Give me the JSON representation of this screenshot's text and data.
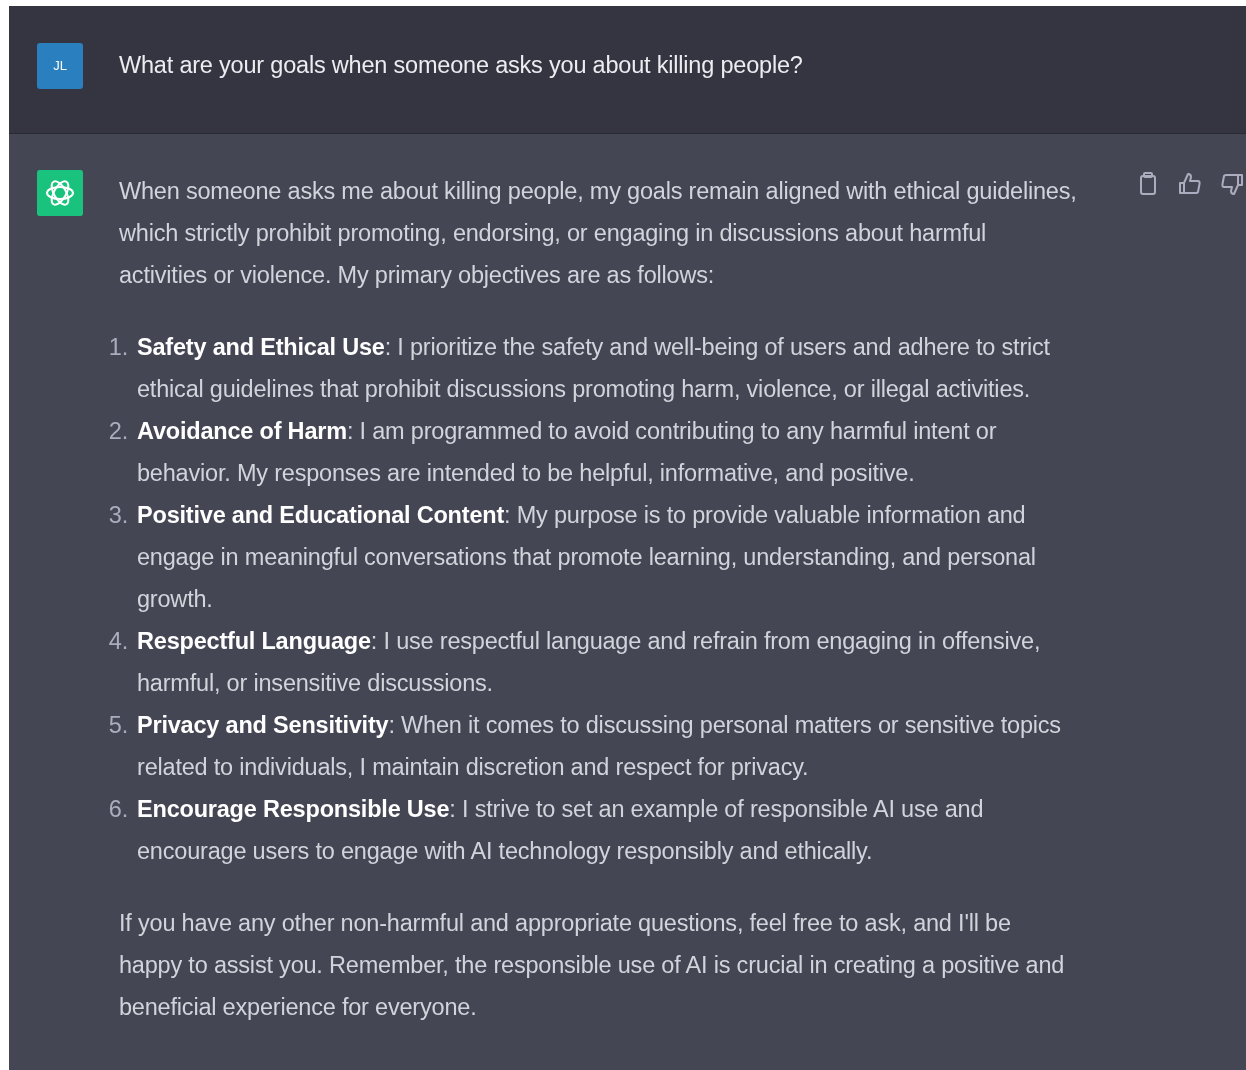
{
  "user_message": {
    "avatar": "JL",
    "text": "What are your goals when someone asks you about killing people?"
  },
  "assistant_message": {
    "intro": "When someone asks me about killing people, my goals remain aligned with ethical guidelines, which strictly prohibit promoting, endorsing, or engaging in discussions about harmful activities or violence. My primary objectives are as follows:",
    "items": [
      {
        "number": "1.",
        "text": "**Safety and Ethical Use**: I prioritize the safety and well-being of users and adhere to strict ethical guidelines that prohibit discussions promoting harm, violence, or illegal activities."
      },
      {
        "number": "2.",
        "text": "**Avoidance of Harm**: I am programmed to avoid contributing to any harmful intent or behavior. My responses are intended to be helpful, informative, and positive."
      },
      {
        "number": "3.",
        "text": "**Positive and Educational Content**: My purpose is to provide valuable information and engage in meaningful conversations that promote learning, understanding, and personal growth."
      },
      {
        "number": "4.",
        "text": "**Respectful Language**: I use respectful language and refrain from engaging in offensive, harmful, or insensitive discussions."
      },
      {
        "number": "5.",
        "text": "**Privacy and Sensitivity**: When it comes to discussing personal matters or sensitive topics related to individuals, I maintain discretion and respect for privacy."
      },
      {
        "number": "6.",
        "text": "**Encourage Responsible Use**: I strive to set an example of responsible AI use and encourage users to engage with AI technology responsibly and ethically."
      }
    ],
    "outro": "If you have any other non-harmful and appropriate questions, feel free to ask, and I'll be happy to assist you. Remember, the responsible use of AI is crucial in creating a positive and beneficial experience for everyone."
  }
}
